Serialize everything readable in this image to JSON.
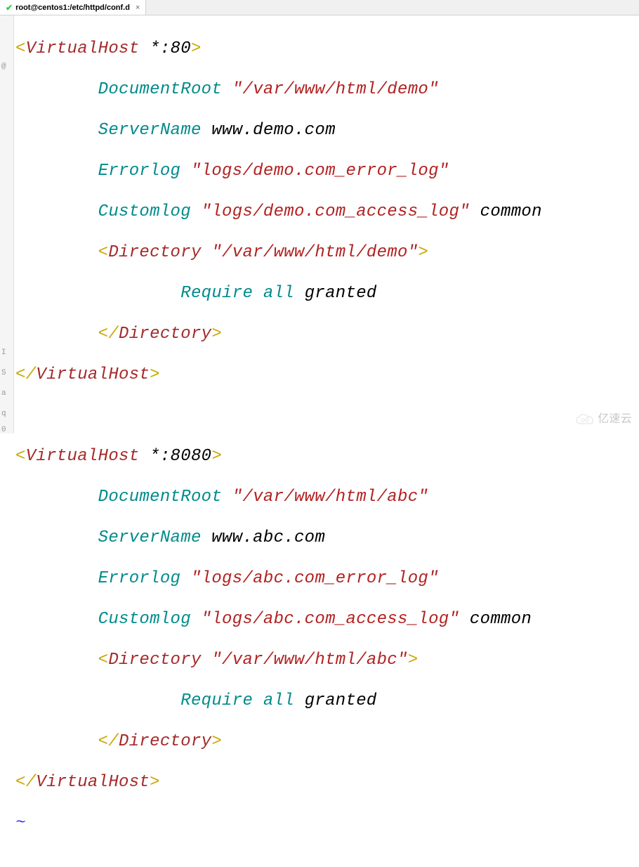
{
  "tab": {
    "title": "root@centos1:/etc/httpd/conf.d",
    "check": "✔",
    "close": "×"
  },
  "gutter": {
    "m1": "I",
    "m2": "S",
    "m3": "a",
    "m4": "q",
    "m5": "0",
    "atmark": "@"
  },
  "watermark": "亿速云",
  "syntax_colors": {
    "punct": "#c9a800",
    "tag": "#a52a2a",
    "attr_directive": "#008b8b",
    "string": "#b22222",
    "plain": "#000000",
    "tilde": "#3333ff"
  },
  "code": {
    "l1": {
      "open": "<",
      "tag": "VirtualHost",
      "sp": " ",
      "arg": "*:80",
      "close": ">"
    },
    "l2": {
      "indent": "        ",
      "dir": "DocumentRoot",
      "sp": " ",
      "val": "\"/var/www/html/demo\""
    },
    "l3": {
      "indent": "        ",
      "dir": "ServerName",
      "sp": " ",
      "val": "www.demo.com"
    },
    "l4": {
      "indent": "        ",
      "dir": "Errorlog",
      "sp": " ",
      "val": "\"logs/demo.com_error_log\""
    },
    "l5": {
      "indent": "        ",
      "dir": "Customlog",
      "sp": " ",
      "val": "\"logs/demo.com_access_log\"",
      "sp2": " ",
      "extra": "common"
    },
    "l6": {
      "indent": "        ",
      "open": "<",
      "tag": "Directory",
      "sp": " ",
      "arg": "\"/var/www/html/demo\"",
      "close": ">"
    },
    "l7": {
      "indent": "                ",
      "dir": "Require",
      "sp": " ",
      "v1": "all",
      "sp2": " ",
      "v2": "granted"
    },
    "l8": {
      "indent": "        ",
      "open": "</",
      "tag": "Directory",
      "close": ">"
    },
    "l9": {
      "open": "</",
      "tag": "VirtualHost",
      "close": ">"
    },
    "l10": {
      "blank": " "
    },
    "l11": {
      "open": "<",
      "tag": "VirtualHost",
      "sp": " ",
      "arg": "*:8080",
      "close": ">"
    },
    "l12": {
      "indent": "        ",
      "dir": "DocumentRoot",
      "sp": " ",
      "val": "\"/var/www/html/abc\""
    },
    "l13": {
      "indent": "        ",
      "dir": "ServerName",
      "sp": " ",
      "val": "www.abc.com"
    },
    "l14": {
      "indent": "        ",
      "dir": "Errorlog",
      "sp": " ",
      "val": "\"logs/abc.com_error_log\""
    },
    "l15": {
      "indent": "        ",
      "dir": "Customlog",
      "sp": " ",
      "val": "\"logs/abc.com_access_log\"",
      "sp2": " ",
      "extra": "common"
    },
    "l16": {
      "indent": "        ",
      "open": "<",
      "tag": "Directory",
      "sp": " ",
      "arg": "\"/var/www/html/abc\"",
      "close": ">"
    },
    "l17": {
      "indent": "                ",
      "dir": "Require",
      "sp": " ",
      "v1": "all",
      "sp2": " ",
      "v2": "granted"
    },
    "l18": {
      "indent": "        ",
      "open": "</",
      "tag": "Directory",
      "close": ">"
    },
    "l19": {
      "open": "</",
      "tag": "VirtualHost",
      "close": ">"
    },
    "l20": {
      "tilde": "~"
    }
  }
}
